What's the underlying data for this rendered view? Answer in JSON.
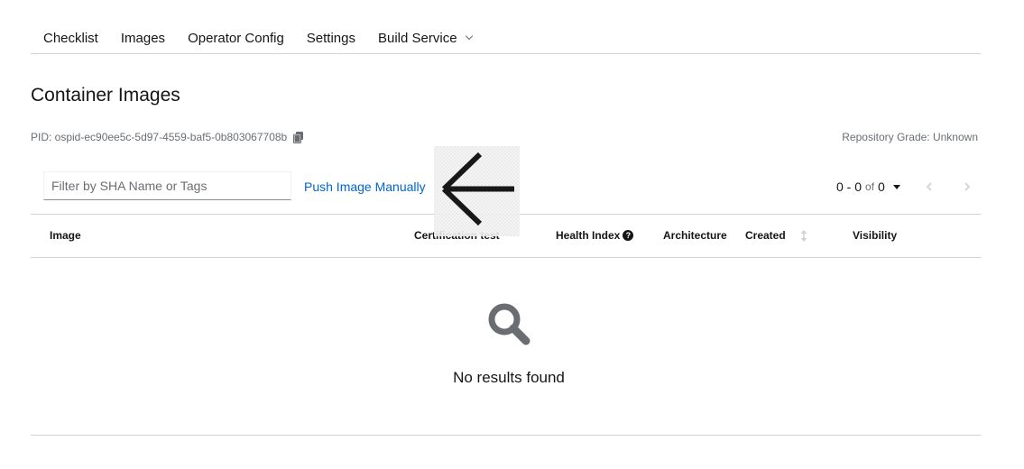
{
  "tabs": {
    "checklist": "Checklist",
    "images": "Images",
    "operator_config": "Operator Config",
    "settings": "Settings",
    "build_service": "Build Service"
  },
  "page_title": "Container Images",
  "pid": "PID: ospid-ec90ee5c-5d97-4559-baf5-0b803067708b",
  "repository_grade": "Repository Grade: Unknown",
  "filter": {
    "placeholder": "Filter by SHA Name or Tags",
    "value": ""
  },
  "push_link": "Push Image Manually",
  "pager": {
    "range": "0 - 0",
    "of": "of",
    "total": "0"
  },
  "table": {
    "headers": {
      "image": "Image",
      "certification": "Certification test",
      "health": "Health Index",
      "architecture": "Architecture",
      "created": "Created",
      "visibility": "Visibility"
    }
  },
  "empty_state": {
    "title": "No results found"
  },
  "icons": {
    "copy": "copy-icon",
    "back_arrow": "arrow-left-icon",
    "help": "question-circle-icon",
    "sort": "sort-icon",
    "search": "search-icon",
    "prev": "angle-left-icon",
    "next": "angle-right-icon",
    "dropdown": "caret-down-icon"
  },
  "colors": {
    "link": "#0066cc",
    "text": "#151515",
    "muted": "#6a6e73",
    "border": "#d2d2d2",
    "empty_icon": "#6a6e73"
  }
}
